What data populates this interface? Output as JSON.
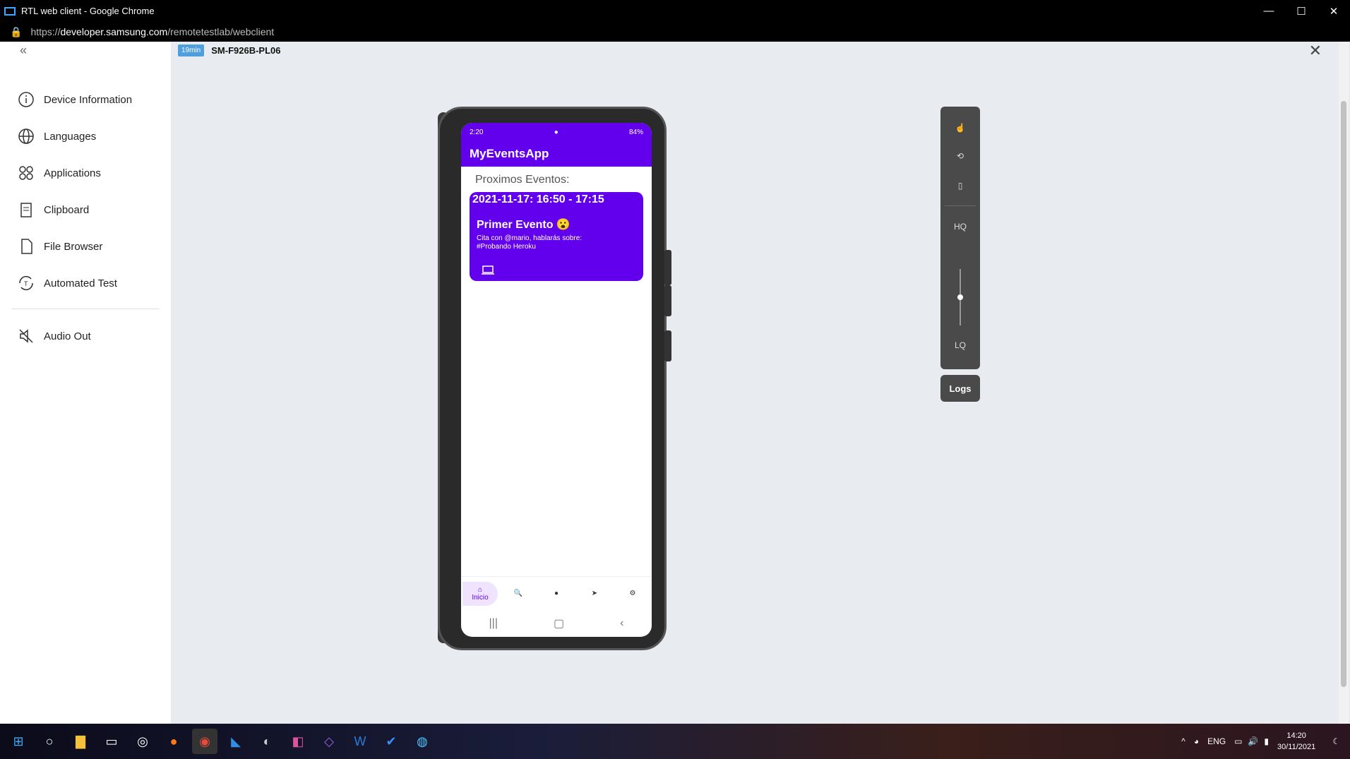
{
  "window": {
    "title": "RTL web client - Google Chrome",
    "url_host": "developer.samsung.com",
    "url_path": "/remotetestlab/webclient",
    "url_scheme": "https://"
  },
  "sidebar": {
    "items": [
      {
        "label": "Device Information",
        "icon": "info-icon"
      },
      {
        "label": "Languages",
        "icon": "globe-icon"
      },
      {
        "label": "Applications",
        "icon": "apps-grid-icon"
      },
      {
        "label": "Clipboard",
        "icon": "clipboard-icon"
      },
      {
        "label": "File Browser",
        "icon": "file-icon"
      },
      {
        "label": "Automated Test",
        "icon": "automated-test-icon"
      }
    ],
    "audio_item": {
      "label": "Audio Out",
      "icon": "speaker-muted-icon"
    }
  },
  "device": {
    "timer": "19min",
    "name": "SM-F926B-PL06"
  },
  "phone": {
    "status_time": "2:20",
    "battery": "84%",
    "app_title": "MyEventsApp",
    "section_label": "Proximos Eventos:",
    "event": {
      "when": "2021-11-17: 16:50 - 17:15",
      "title": "Primer Evento 😮",
      "desc1": "Cita con @mario, hablarás sobre:",
      "desc2": "#Probando Heroku"
    },
    "nav": {
      "home_label": "Inicio"
    }
  },
  "controls": {
    "hq": "HQ",
    "lq": "LQ",
    "logs": "Logs"
  },
  "taskbar": {
    "lang": "ENG",
    "time": "14:20",
    "date": "30/11/2021"
  },
  "colors": {
    "accent": "#6200ee",
    "timer_badge": "#4f9fdf"
  }
}
